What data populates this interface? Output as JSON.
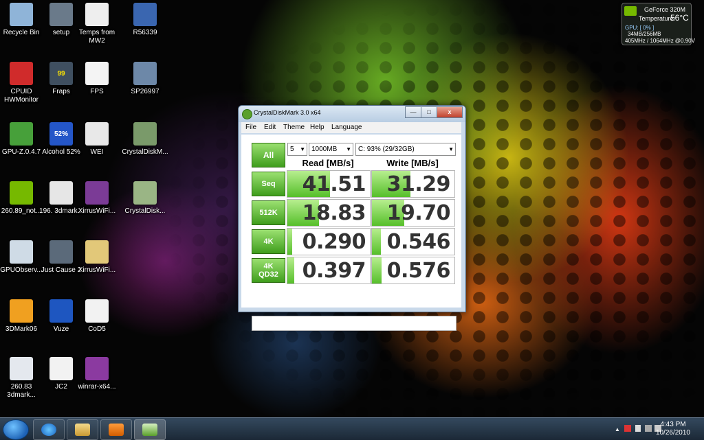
{
  "desktop": {
    "icons": [
      {
        "label": "Recycle Bin",
        "icon": "recycle-bin-icon"
      },
      {
        "label": "setup",
        "icon": "setup-icon"
      },
      {
        "label": "Temps from MW2",
        "icon": "document-icon"
      },
      {
        "label": "R56339",
        "icon": "robot-icon"
      },
      {
        "label": "CPUID HWMonitor",
        "icon": "hwmonitor-icon"
      },
      {
        "label": "Fraps",
        "icon": "fraps-icon",
        "badge": "99"
      },
      {
        "label": "FPS",
        "icon": "document-icon"
      },
      {
        "label": "SP26997",
        "icon": "sail-icon"
      },
      {
        "label": "GPU-Z.0.4.7",
        "icon": "gpu-icon"
      },
      {
        "label": "Alcohol 52%",
        "icon": "alcohol-icon",
        "badge": "52%"
      },
      {
        "label": "WEI",
        "icon": "document-icon"
      },
      {
        "label": "CrystalDiskM...",
        "icon": "crystaldisk-icon"
      },
      {
        "label": "260.89_not...",
        "icon": "nvidia-icon"
      },
      {
        "label": "196. 3dmark...",
        "icon": "document-icon"
      },
      {
        "label": "XirrusWiFi...",
        "icon": "archive-icon"
      },
      {
        "label": "CrystalDisk...",
        "icon": "crystaldisk-icon"
      },
      {
        "label": "GPUObserv...",
        "icon": "clock-icon"
      },
      {
        "label": "Just Cause 2",
        "icon": "game-icon"
      },
      {
        "label": "XirrusWiFi...",
        "icon": "folder-icon"
      },
      {
        "label": "3DMark06",
        "icon": "3dmark-icon"
      },
      {
        "label": "Vuze",
        "icon": "vuze-icon"
      },
      {
        "label": "CoD5",
        "icon": "document-icon"
      },
      {
        "label": "260.83 3dmark...",
        "icon": "document-icon"
      },
      {
        "label": "JC2",
        "icon": "document-icon"
      },
      {
        "label": "winrar-x64...",
        "icon": "winrar-icon"
      }
    ]
  },
  "gadget": {
    "title": "GeForce 320M",
    "temp_label": "Temperature:",
    "temp_value": "56°C",
    "gpu_label": "GPU: [ 0% ]",
    "mem": "34MB/256MB",
    "clocks": "405MHz / 1064MHz @0.90V"
  },
  "window": {
    "title": "CrystalDiskMark 3.0 x64",
    "controls": {
      "minimize": "—",
      "maximize": "□",
      "close": "x"
    },
    "menu": [
      "File",
      "Edit",
      "Theme",
      "Help",
      "Language"
    ],
    "all_label": "All",
    "count": "5",
    "size": "1000MB",
    "drive": "C: 93% (29/32GB)",
    "read_header": "Read [MB/s]",
    "write_header": "Write [MB/s]",
    "rows": [
      {
        "label": "Seq",
        "read": "41.51",
        "write": "31.29",
        "read_frac": 0.52,
        "write_frac": 0.47
      },
      {
        "label": "512K",
        "read": "18.83",
        "write": "19.70",
        "read_frac": 0.38,
        "write_frac": 0.39
      },
      {
        "label": "4K",
        "read": "0.290",
        "write": "0.546",
        "read_frac": 0.06,
        "write_frac": 0.11
      },
      {
        "label": "4K\nQD32",
        "read": "0.397",
        "write": "0.576",
        "read_frac": 0.08,
        "write_frac": 0.12
      }
    ]
  },
  "taskbar": {
    "buttons": [
      "start-button",
      "internet-explorer",
      "windows-explorer",
      "media-player",
      "crystaldiskmark"
    ],
    "time": "4:43 PM",
    "date": "10/26/2010"
  }
}
